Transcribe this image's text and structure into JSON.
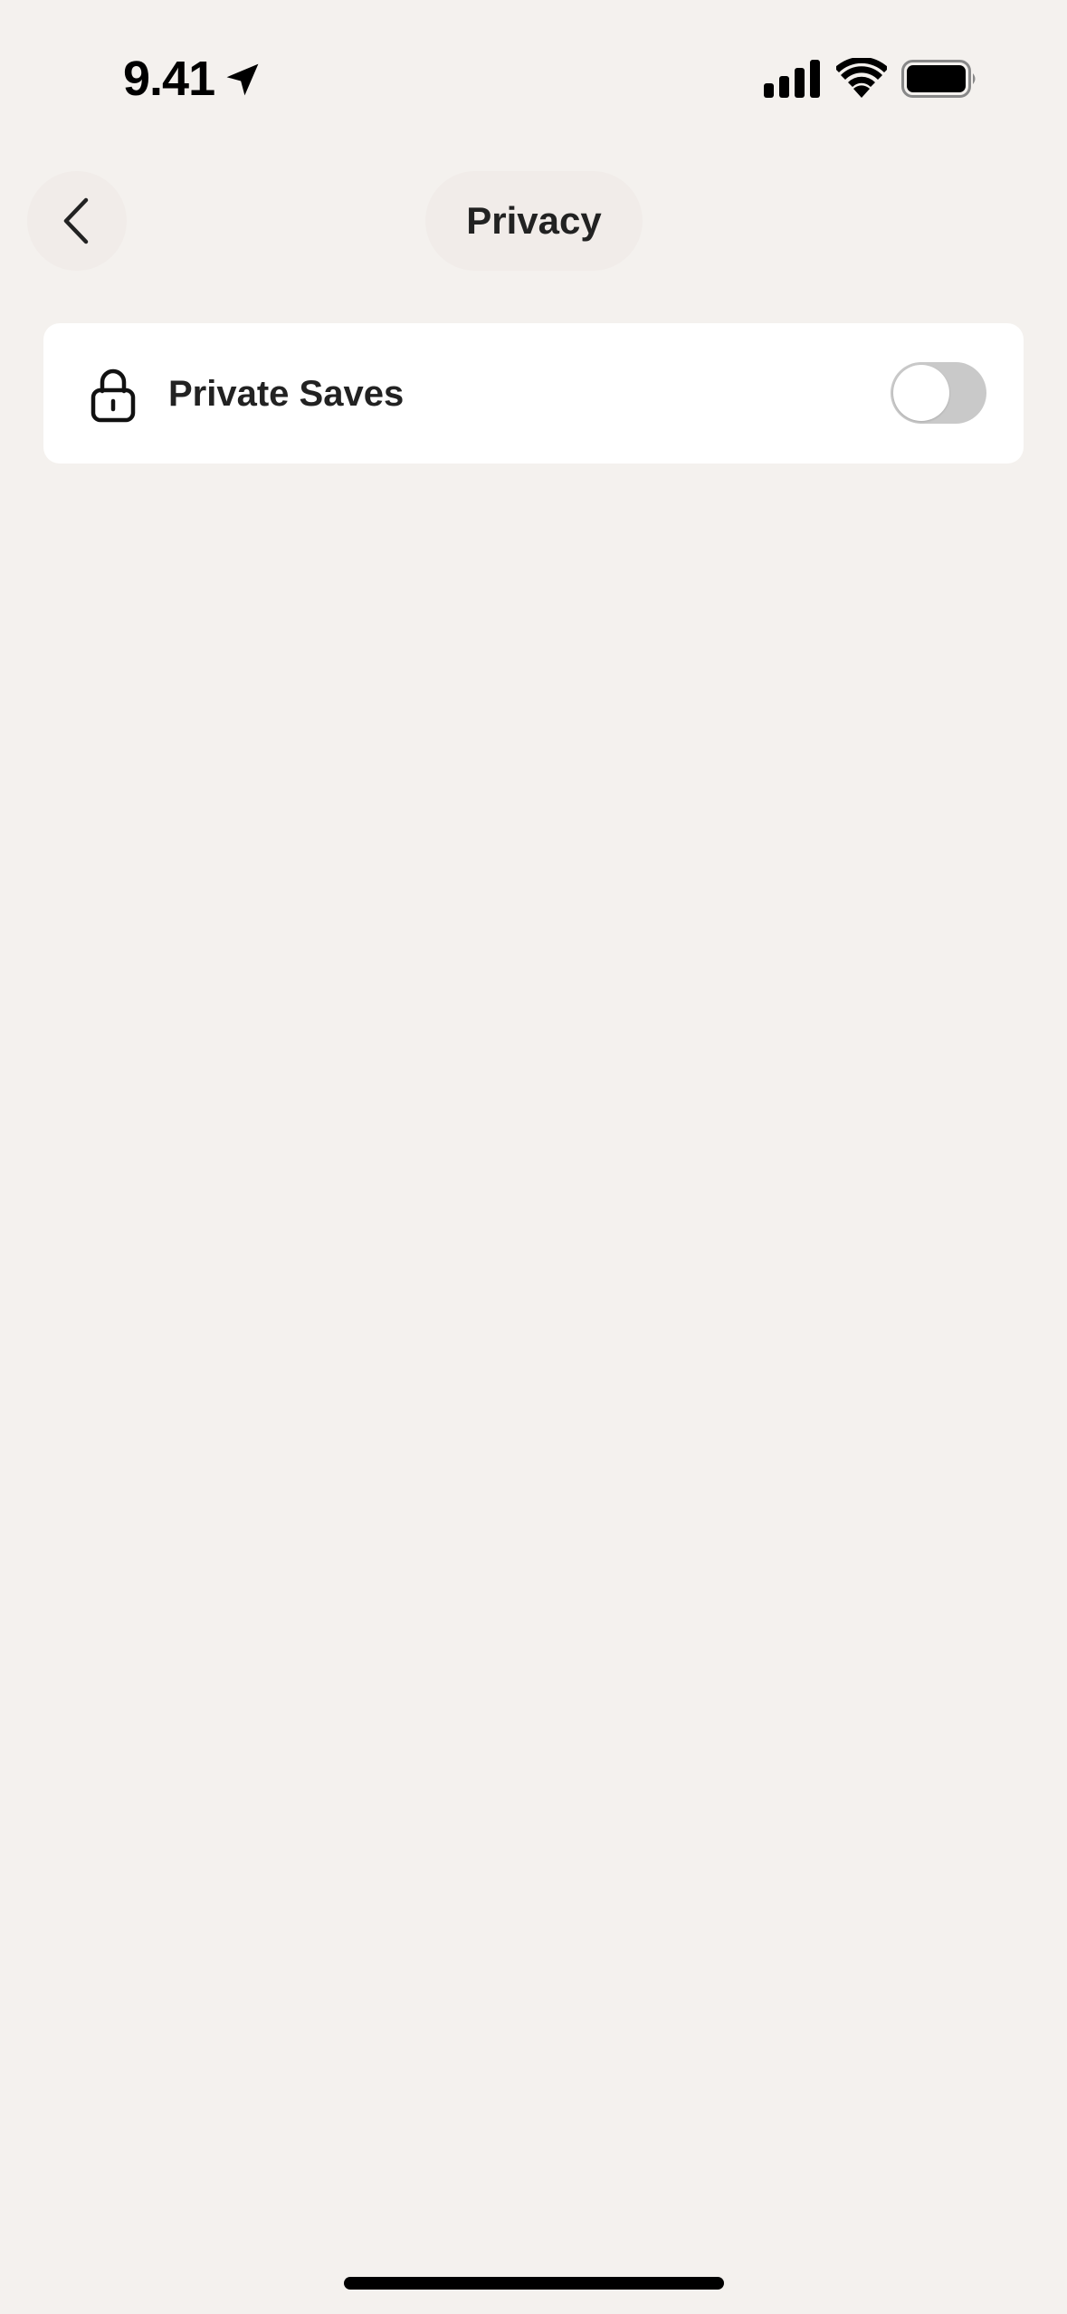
{
  "status_bar": {
    "time": "9.41",
    "icons": [
      "location-icon",
      "signal-icon",
      "wifi-icon",
      "battery-icon"
    ]
  },
  "header": {
    "back_icon": "chevron-left-icon",
    "title": "Privacy"
  },
  "settings": {
    "items": [
      {
        "icon": "lock-icon",
        "label": "Private Saves",
        "toggle_on": false
      }
    ]
  },
  "colors": {
    "background": "#f4f1ee",
    "card": "#ffffff",
    "toggle_off": "#c9c9c9",
    "text": "#222222"
  }
}
